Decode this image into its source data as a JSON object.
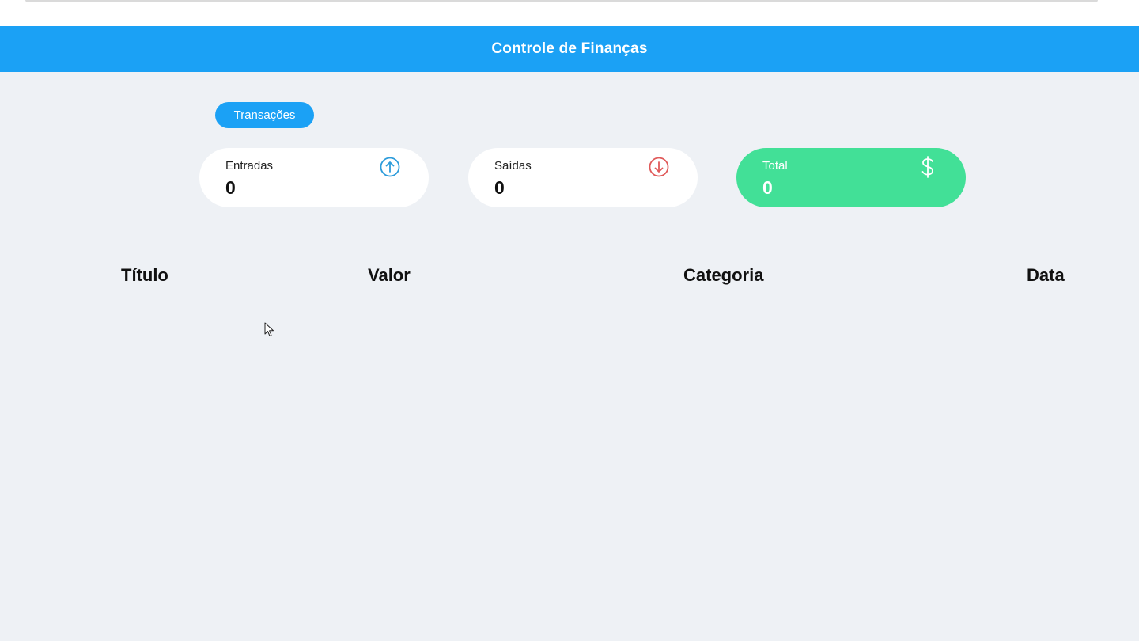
{
  "header": {
    "title": "Controle de Finanças"
  },
  "tabs": {
    "transactions_label": "Transações"
  },
  "cards": {
    "entradas": {
      "label": "Entradas",
      "value": "0",
      "icon": "arrow-up-circle-icon",
      "color": "#2d9cdb"
    },
    "saidas": {
      "label": "Saídas",
      "value": "0",
      "icon": "arrow-down-circle-icon",
      "color": "#e05a5a"
    },
    "total": {
      "label": "Total",
      "value": "0",
      "icon": "dollar-icon",
      "color": "#42e097"
    }
  },
  "table": {
    "columns": [
      "Título",
      "Valor",
      "Categoria",
      "Data"
    ]
  },
  "colors": {
    "accent": "#1ba1f5",
    "background": "#eef1f5"
  }
}
